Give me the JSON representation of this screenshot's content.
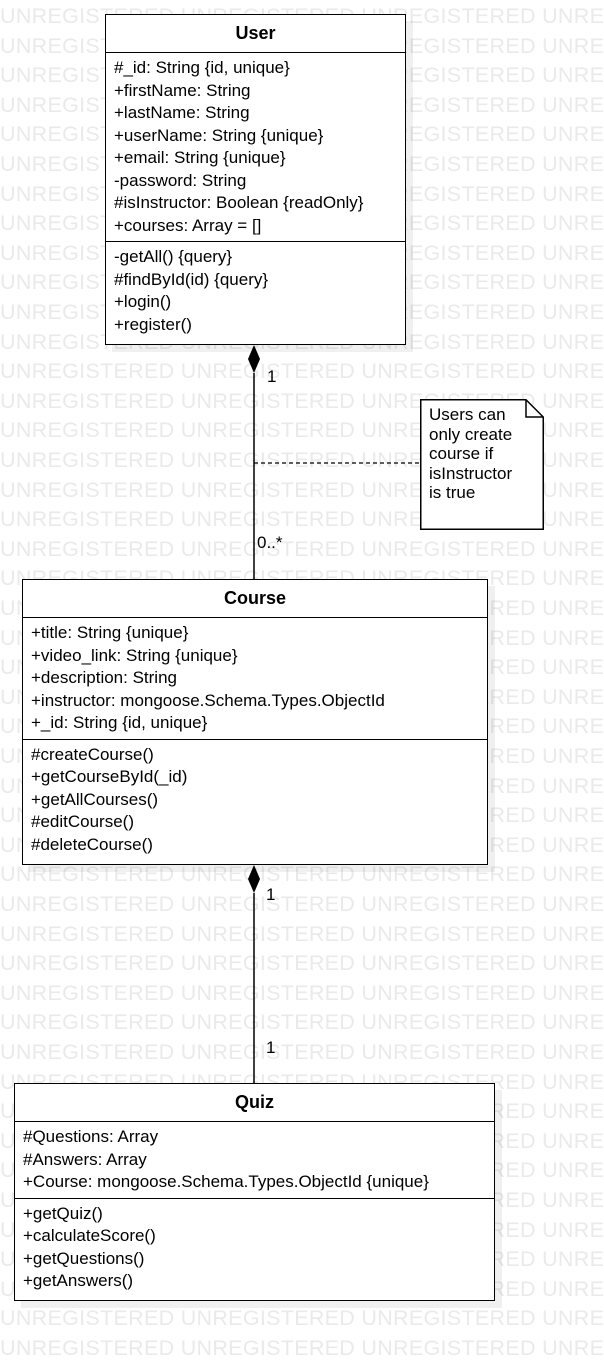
{
  "watermark": "UNREGISTERED",
  "classes": {
    "user": {
      "name": "User",
      "attributes": [
        "#_id: String {id, unique}",
        "+firstName: String",
        "+lastName: String",
        "+userName: String {unique}",
        "+email: String {unique}",
        "-password: String",
        "#isInstructor: Boolean {readOnly}",
        "+courses: Array = []"
      ],
      "operations": [
        "-getAll() {query}",
        "#findById(id) {query}",
        "+login()",
        "+register()"
      ]
    },
    "course": {
      "name": "Course",
      "attributes": [
        "+title: String {unique}",
        "+video_link: String {unique}",
        "+description: String",
        "+instructor: mongoose.Schema.Types.ObjectId",
        "+_id: String {id, unique}"
      ],
      "operations": [
        "#createCourse()",
        "+getCourseById(_id)",
        "+getAllCourses()",
        "#editCourse()",
        "#deleteCourse()"
      ]
    },
    "quiz": {
      "name": "Quiz",
      "attributes": [
        "#Questions: Array",
        "#Answers: Array",
        "+Course: mongoose.Schema.Types.ObjectId {unique}"
      ],
      "operations": [
        "+getQuiz()",
        "+calculateScore()",
        "+getQuestions()",
        "+getAnswers()"
      ]
    }
  },
  "associations": {
    "user_course": {
      "source_multiplicity": "1",
      "target_multiplicity": "0..*"
    },
    "course_quiz": {
      "source_multiplicity": "1",
      "target_multiplicity": "1"
    }
  },
  "note": {
    "text": "Users can\nonly create\ncourse if\nisInstructor\nis true"
  }
}
